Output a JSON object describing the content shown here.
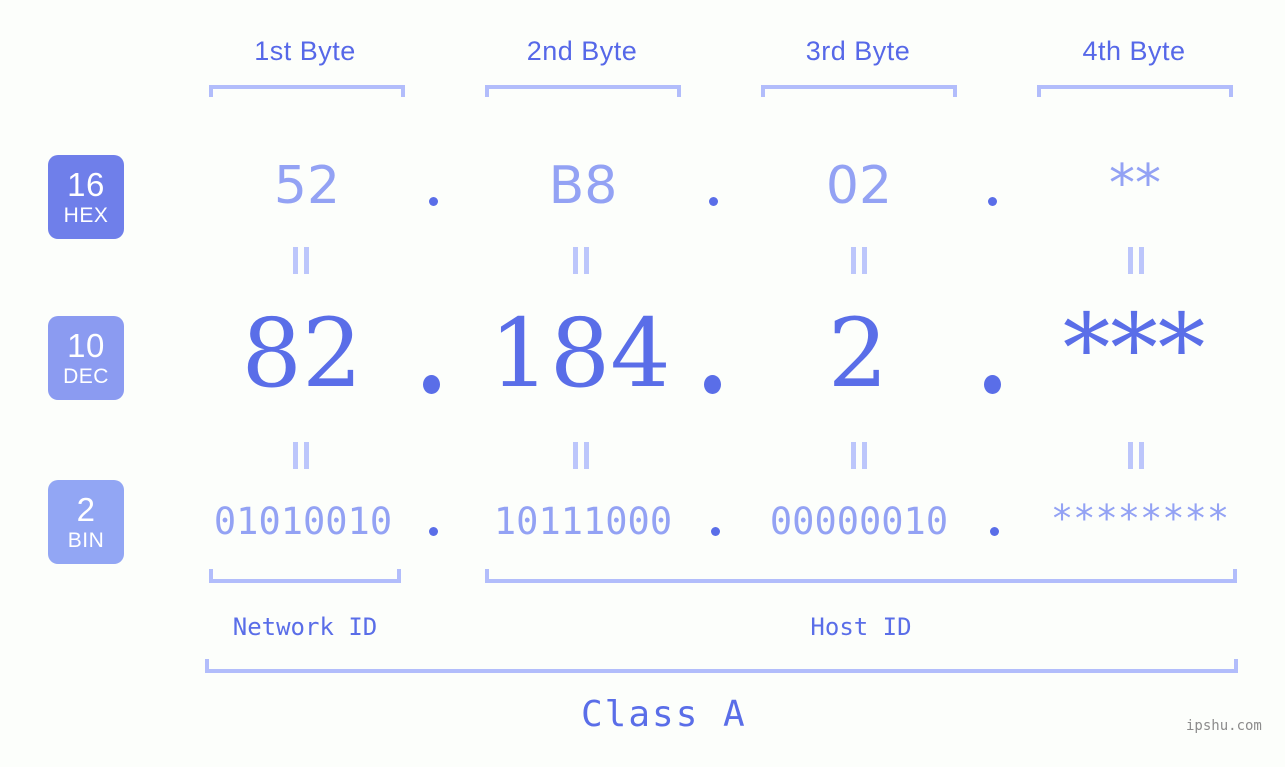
{
  "meta": {
    "background_color": "#fcfefb",
    "accent_color": "#5a6ee8",
    "light_accent_color": "#93a2f4",
    "bracket_color": "#b2bdfb",
    "watermark": "ipshu.com"
  },
  "byte_headers": [
    {
      "label": "1st Byte"
    },
    {
      "label": "2nd Byte"
    },
    {
      "label": "3rd Byte"
    },
    {
      "label": "4th Byte"
    }
  ],
  "rows": [
    {
      "id": "hex",
      "badge_base": "16",
      "badge_name": "HEX",
      "badge_color": "#6f7fea",
      "values": [
        "52",
        "B8",
        "02",
        "**"
      ],
      "separator": "."
    },
    {
      "id": "dec",
      "badge_base": "10",
      "badge_name": "DEC",
      "badge_color": "#8b9bf1",
      "values": [
        "82",
        "184",
        "2",
        "***"
      ],
      "separator": "."
    },
    {
      "id": "bin",
      "badge_base": "2",
      "badge_name": "BIN",
      "badge_color": "#92a6f4",
      "values": [
        "01010010",
        "10111000",
        "00000010",
        "********"
      ],
      "separator": "."
    }
  ],
  "equals_marks": {
    "symbol": "=",
    "count_per_gap": 4,
    "gaps": 2
  },
  "id_sections": [
    {
      "label": "Network ID"
    },
    {
      "label": "Host ID"
    }
  ],
  "class_section": {
    "label": "Class A"
  }
}
